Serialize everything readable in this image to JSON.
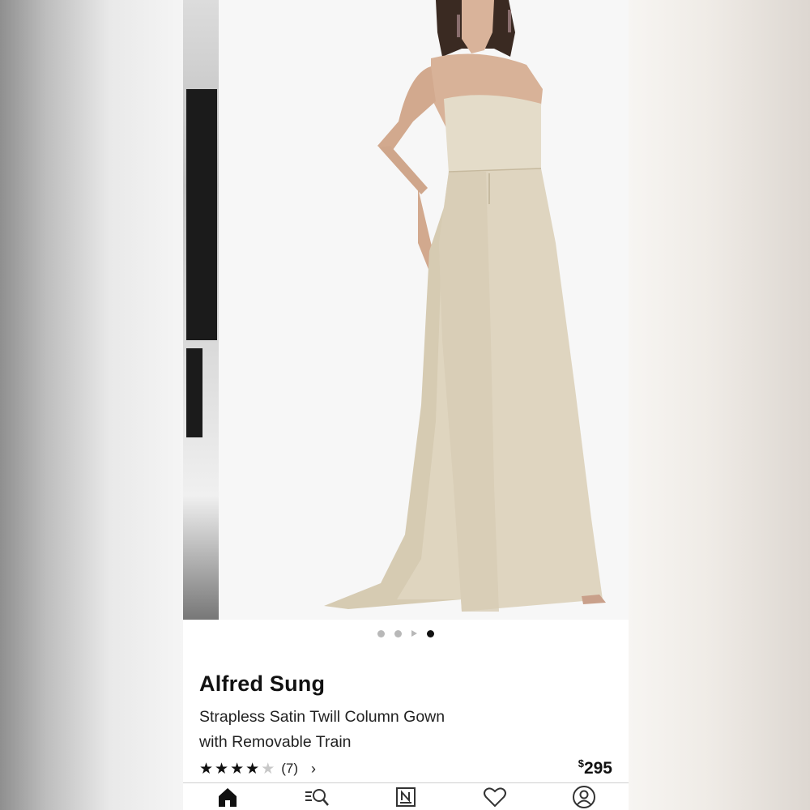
{
  "gallery": {
    "dots": [
      false,
      false,
      "video",
      true
    ]
  },
  "product": {
    "brand": "Alfred Sung",
    "title": "Strapless Satin Twill Column Gown with Removable Train",
    "rating": 4,
    "rating_max": 5,
    "review_count": "(7)",
    "reviews_chevron": "›",
    "price_currency": "$",
    "price_amount": "295"
  },
  "tabbar": {
    "items": [
      {
        "name": "home",
        "icon": "home-icon",
        "active": true
      },
      {
        "name": "search",
        "icon": "search-icon"
      },
      {
        "name": "nordstrom",
        "icon": "nordstrom-icon"
      },
      {
        "name": "wishlist",
        "icon": "heart-icon"
      },
      {
        "name": "account",
        "icon": "account-icon"
      }
    ]
  },
  "colors": {
    "gown": "#dcd2bb",
    "background": "#f7f7f7",
    "active_dot": "#111111"
  }
}
